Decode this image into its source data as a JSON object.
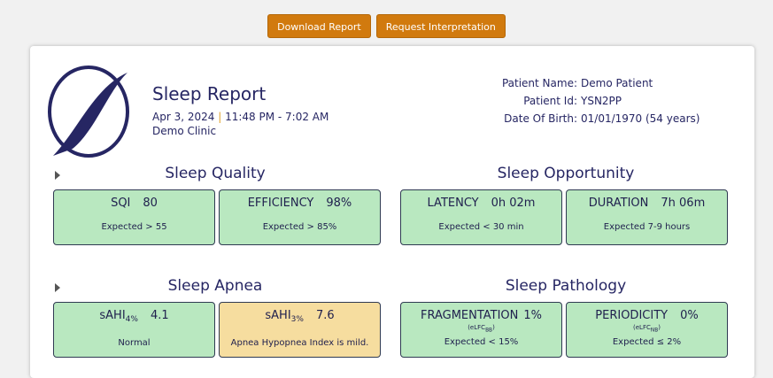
{
  "toolbar": {
    "download_label": "Download Report",
    "interpret_label": "Request Interpretation",
    "button_color": "#d17a0e"
  },
  "report": {
    "title": "Sleep Report",
    "date": "Apr 3, 2024",
    "separator": "|",
    "time_range": "11:48 PM - 7:02 AM",
    "clinic": "Demo Clinic",
    "logo_icon": "sleep-logo-icon"
  },
  "patient": {
    "name_label": "Patient Name:",
    "name": "Demo Patient",
    "id_label": "Patient Id:",
    "id": "YSN2PP",
    "dob_label": "Date Of Birth:",
    "dob": "01/01/1970 (54 years)"
  },
  "sections": {
    "quality": "Sleep Quality",
    "opportunity": "Sleep Opportunity",
    "apnea": "Sleep Apnea",
    "pathology": "Sleep Pathology"
  },
  "tiles": {
    "sqi": {
      "label": "SQI",
      "value": "80",
      "expected": "Expected > 55"
    },
    "efficiency": {
      "label": "EFFICIENCY",
      "value": "98%",
      "expected": "Expected > 85%"
    },
    "latency": {
      "label": "LATENCY",
      "value": "0h 02m",
      "expected": "Expected < 30 min"
    },
    "duration": {
      "label": "DURATION",
      "value": "7h 06m",
      "expected": "Expected 7-9 hours"
    },
    "sahi4": {
      "label": "sAHI",
      "sub": "4%",
      "value": "4.1",
      "note": "Normal"
    },
    "sahi3": {
      "label": "sAHI",
      "sub": "3%",
      "value": "7.6",
      "note": "Apnea Hypopnea Index is mild."
    },
    "fragmentation": {
      "label": "FRAGMENTATION",
      "value": "1%",
      "sub_label": "(eLFC",
      "sub_index": "BB",
      "sub_close": ")",
      "expected": "Expected < 15%"
    },
    "periodicity": {
      "label": "PERIODICITY",
      "value": "0%",
      "sub_label": "(eLFC",
      "sub_index": "NB",
      "sub_close": ")",
      "expected": "Expected ≤ 2%"
    }
  },
  "colors": {
    "normal_tile": "#b9e8c0",
    "warning_tile": "#f6dd9f",
    "text": "#262663",
    "separator": "#e0a12a"
  }
}
